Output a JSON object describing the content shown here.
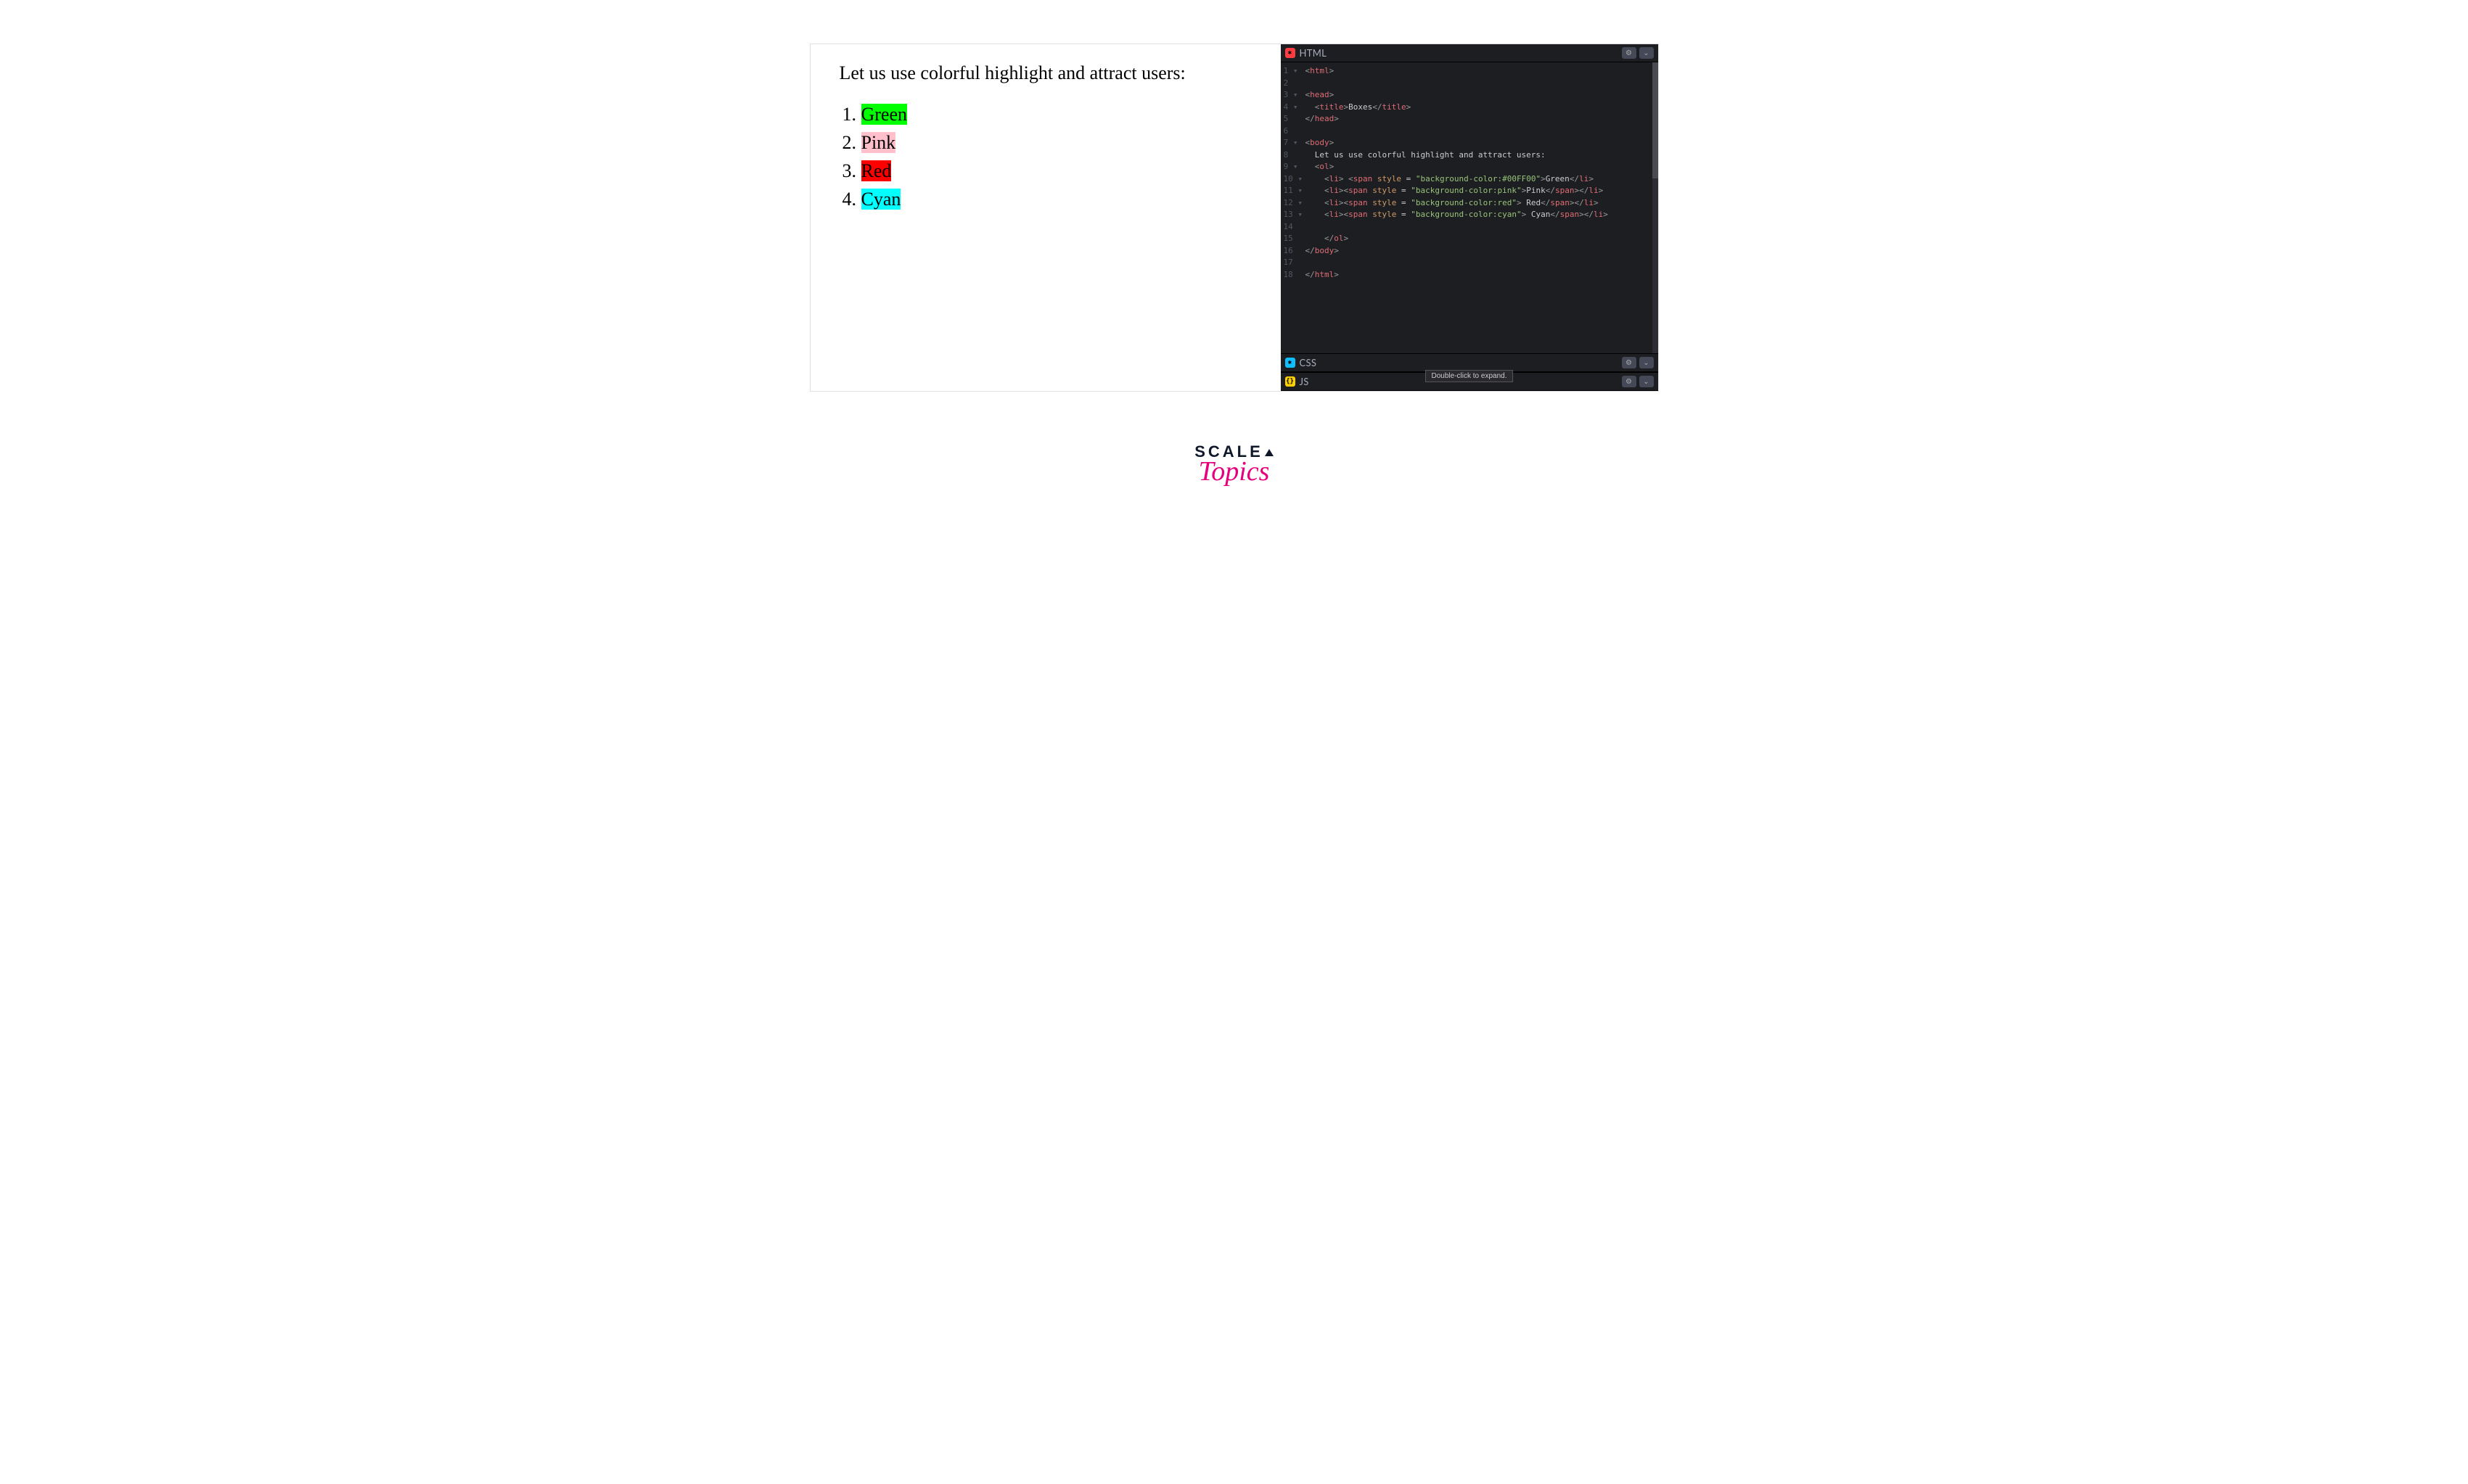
{
  "preview": {
    "intro": "Let us use colorful highlight and attract users:",
    "items": [
      {
        "label": "Green",
        "class": "hl-green"
      },
      {
        "label": "Pink",
        "class": "hl-pink"
      },
      {
        "label": "Red",
        "class": "hl-red"
      },
      {
        "label": "Cyan",
        "class": "hl-cyan"
      }
    ]
  },
  "editor": {
    "html_label": "HTML",
    "css_label": "CSS",
    "js_label": "JS",
    "tooltip": "Double-click to expand.",
    "code_lines": [
      {
        "num": "1",
        "fold": true,
        "segments": [
          {
            "t": "<",
            "c": "tag-bracket"
          },
          {
            "t": "html",
            "c": "tag-name"
          },
          {
            "t": ">",
            "c": "tag-bracket"
          }
        ],
        "indent": 0
      },
      {
        "num": "2",
        "segments": [],
        "indent": 0
      },
      {
        "num": "3",
        "fold": true,
        "segments": [
          {
            "t": "<",
            "c": "tag-bracket"
          },
          {
            "t": "head",
            "c": "tag-name"
          },
          {
            "t": ">",
            "c": "tag-bracket"
          }
        ],
        "indent": 0
      },
      {
        "num": "4",
        "fold": true,
        "segments": [
          {
            "t": "<",
            "c": "tag-bracket"
          },
          {
            "t": "title",
            "c": "tag-name"
          },
          {
            "t": ">",
            "c": "tag-bracket"
          },
          {
            "t": "Boxes",
            "c": "text-content"
          },
          {
            "t": "</",
            "c": "tag-bracket"
          },
          {
            "t": "title",
            "c": "tag-name"
          },
          {
            "t": ">",
            "c": "tag-bracket"
          }
        ],
        "indent": 1
      },
      {
        "num": "5",
        "segments": [
          {
            "t": "</",
            "c": "tag-bracket"
          },
          {
            "t": "head",
            "c": "tag-name"
          },
          {
            "t": ">",
            "c": "tag-bracket"
          }
        ],
        "indent": 0
      },
      {
        "num": "6",
        "segments": [],
        "indent": 0
      },
      {
        "num": "7",
        "fold": true,
        "segments": [
          {
            "t": "<",
            "c": "tag-bracket"
          },
          {
            "t": "body",
            "c": "tag-name"
          },
          {
            "t": ">",
            "c": "tag-bracket"
          }
        ],
        "indent": 0
      },
      {
        "num": "8",
        "segments": [
          {
            "t": "Let us use colorful highlight and attract users:",
            "c": "text-content"
          }
        ],
        "indent": 1
      },
      {
        "num": "9",
        "fold": true,
        "segments": [
          {
            "t": "<",
            "c": "tag-bracket"
          },
          {
            "t": "ol",
            "c": "tag-name"
          },
          {
            "t": ">",
            "c": "tag-bracket"
          }
        ],
        "indent": 1
      },
      {
        "num": "10",
        "fold": true,
        "segments": [
          {
            "t": "<",
            "c": "tag-bracket"
          },
          {
            "t": "li",
            "c": "tag-name"
          },
          {
            "t": "> ",
            "c": "tag-bracket"
          },
          {
            "t": "<",
            "c": "tag-bracket"
          },
          {
            "t": "span",
            "c": "tag-name"
          },
          {
            "t": " ",
            "c": "text-content"
          },
          {
            "t": "style",
            "c": "attr-name"
          },
          {
            "t": " = ",
            "c": "attr-eq"
          },
          {
            "t": "\"background-color:#00FF00\"",
            "c": "attr-value"
          },
          {
            "t": ">",
            "c": "tag-bracket"
          },
          {
            "t": "Green",
            "c": "text-content"
          },
          {
            "t": "</",
            "c": "tag-bracket"
          },
          {
            "t": "li",
            "c": "tag-name"
          },
          {
            "t": ">",
            "c": "tag-bracket"
          }
        ],
        "indent": 2
      },
      {
        "num": "11",
        "fold": true,
        "segments": [
          {
            "t": "<",
            "c": "tag-bracket"
          },
          {
            "t": "li",
            "c": "tag-name"
          },
          {
            "t": ">",
            "c": "tag-bracket"
          },
          {
            "t": "<",
            "c": "tag-bracket"
          },
          {
            "t": "span",
            "c": "tag-name"
          },
          {
            "t": " ",
            "c": "text-content"
          },
          {
            "t": "style",
            "c": "attr-name"
          },
          {
            "t": " = ",
            "c": "attr-eq"
          },
          {
            "t": "\"background-color:pink\"",
            "c": "attr-value"
          },
          {
            "t": ">",
            "c": "tag-bracket"
          },
          {
            "t": "Pink",
            "c": "text-content"
          },
          {
            "t": "</",
            "c": "tag-bracket"
          },
          {
            "t": "span",
            "c": "tag-name"
          },
          {
            "t": ">",
            "c": "tag-bracket"
          },
          {
            "t": "</",
            "c": "tag-bracket"
          },
          {
            "t": "li",
            "c": "tag-name"
          },
          {
            "t": ">",
            "c": "tag-bracket"
          }
        ],
        "indent": 2
      },
      {
        "num": "12",
        "fold": true,
        "segments": [
          {
            "t": "<",
            "c": "tag-bracket"
          },
          {
            "t": "li",
            "c": "tag-name"
          },
          {
            "t": ">",
            "c": "tag-bracket"
          },
          {
            "t": "<",
            "c": "tag-bracket"
          },
          {
            "t": "span",
            "c": "tag-name"
          },
          {
            "t": " ",
            "c": "text-content"
          },
          {
            "t": "style",
            "c": "attr-name"
          },
          {
            "t": " = ",
            "c": "attr-eq"
          },
          {
            "t": "\"background-color:red\"",
            "c": "attr-value"
          },
          {
            "t": ">",
            "c": "tag-bracket"
          },
          {
            "t": " Red",
            "c": "text-content"
          },
          {
            "t": "</",
            "c": "tag-bracket"
          },
          {
            "t": "span",
            "c": "tag-name"
          },
          {
            "t": ">",
            "c": "tag-bracket"
          },
          {
            "t": "</",
            "c": "tag-bracket"
          },
          {
            "t": "li",
            "c": "tag-name"
          },
          {
            "t": ">",
            "c": "tag-bracket"
          }
        ],
        "indent": 2
      },
      {
        "num": "13",
        "fold": true,
        "segments": [
          {
            "t": "<",
            "c": "tag-bracket"
          },
          {
            "t": "li",
            "c": "tag-name"
          },
          {
            "t": ">",
            "c": "tag-bracket"
          },
          {
            "t": "<",
            "c": "tag-bracket"
          },
          {
            "t": "span",
            "c": "tag-name"
          },
          {
            "t": " ",
            "c": "text-content"
          },
          {
            "t": "style",
            "c": "attr-name"
          },
          {
            "t": " = ",
            "c": "attr-eq"
          },
          {
            "t": "\"background-color:cyan\"",
            "c": "attr-value"
          },
          {
            "t": ">",
            "c": "tag-bracket"
          },
          {
            "t": " Cyan",
            "c": "text-content"
          },
          {
            "t": "</",
            "c": "tag-bracket"
          },
          {
            "t": "span",
            "c": "tag-name"
          },
          {
            "t": ">",
            "c": "tag-bracket"
          },
          {
            "t": "</",
            "c": "tag-bracket"
          },
          {
            "t": "li",
            "c": "tag-name"
          },
          {
            "t": ">",
            "c": "tag-bracket"
          }
        ],
        "indent": 2
      },
      {
        "num": "14",
        "segments": [],
        "indent": 0
      },
      {
        "num": "15",
        "segments": [
          {
            "t": "</",
            "c": "tag-bracket"
          },
          {
            "t": "ol",
            "c": "tag-name"
          },
          {
            "t": ">",
            "c": "tag-bracket"
          }
        ],
        "indent": 2
      },
      {
        "num": "16",
        "segments": [
          {
            "t": "</",
            "c": "tag-bracket"
          },
          {
            "t": "body",
            "c": "tag-name"
          },
          {
            "t": ">",
            "c": "tag-bracket"
          }
        ],
        "indent": 0
      },
      {
        "num": "17",
        "segments": [],
        "indent": 0
      },
      {
        "num": "18",
        "segments": [
          {
            "t": "</",
            "c": "tag-bracket"
          },
          {
            "t": "html",
            "c": "tag-name"
          },
          {
            "t": ">",
            "c": "tag-bracket"
          }
        ],
        "indent": 0
      }
    ]
  },
  "logo": {
    "top": "SCALE",
    "bottom": "Topics"
  }
}
